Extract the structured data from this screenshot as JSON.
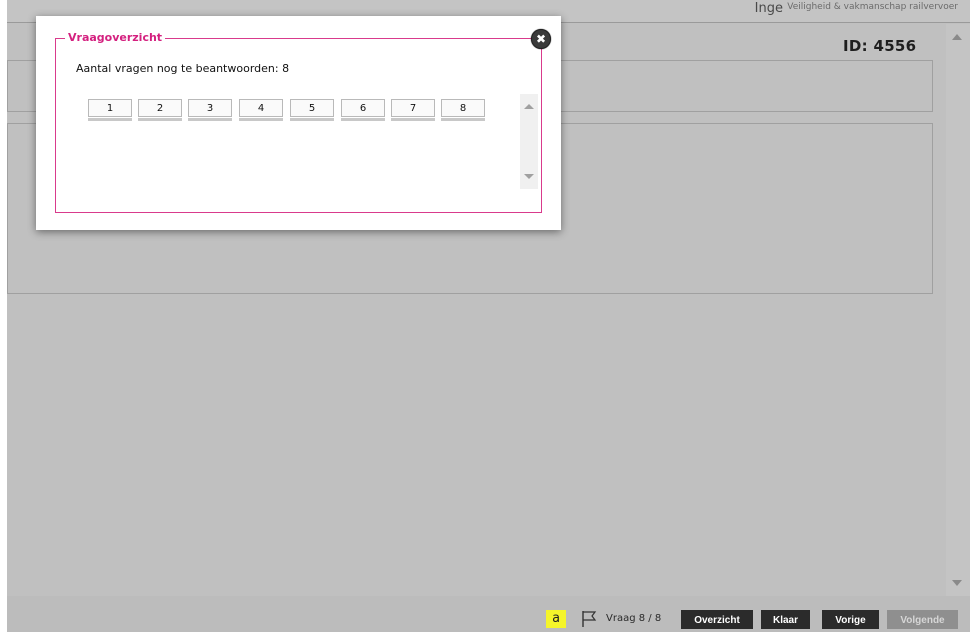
{
  "header": {
    "user_name": "Inge",
    "course_title": "Veiligheid & vakmanschap railvervoer",
    "question_id": "ID: 4556"
  },
  "footer": {
    "font_size_label": "a",
    "flag_icon": "flag-icon",
    "question_counter": "Vraag 8 / 8",
    "overview_label": "Overzicht",
    "done_label": "Klaar",
    "previous_label": "Vorige",
    "next_label": "Volgende"
  },
  "modal": {
    "title": "Vraagoverzicht",
    "close_symbol": "✖",
    "remaining_text": "Aantal vragen nog te beantwoorden: 8",
    "questions": [
      "1",
      "2",
      "3",
      "4",
      "5",
      "6",
      "7",
      "8"
    ]
  },
  "colors": {
    "accent": "#d4207f",
    "disabled_button": "#8f8f8f",
    "primary_button": "#2b2b2b",
    "highlight": "#f5f52a"
  }
}
